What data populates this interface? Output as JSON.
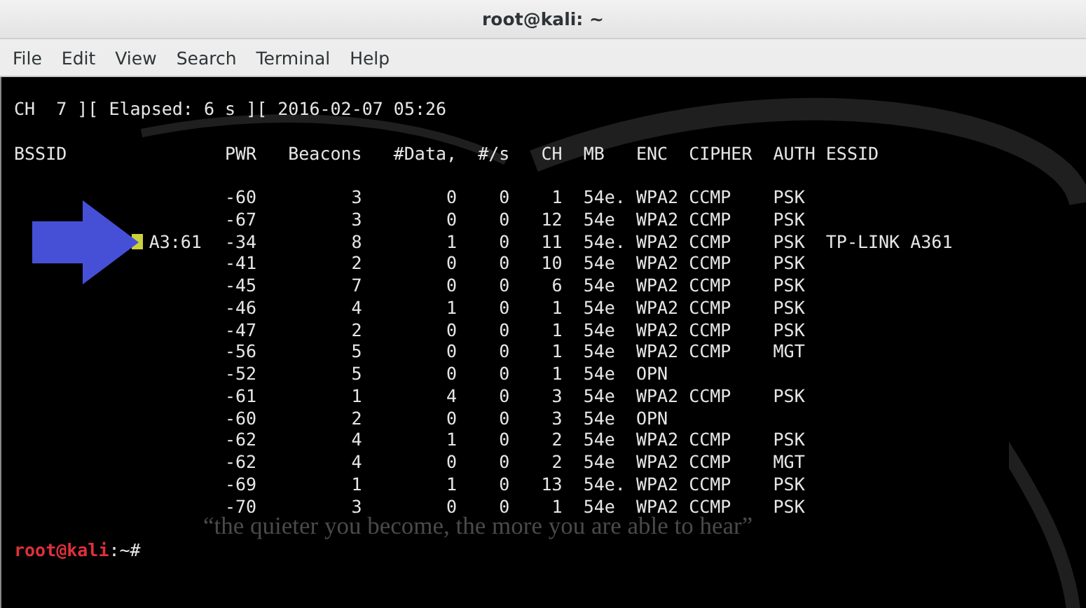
{
  "window": {
    "title": "root@kali: ~"
  },
  "menu": [
    "File",
    "Edit",
    "View",
    "Search",
    "Terminal",
    "Help"
  ],
  "status_line": "CH  7 ][ Elapsed: 6 s ][ 2016-02-07 05:26",
  "table": {
    "columns": [
      "BSSID",
      "PWR",
      "Beacons",
      "#Data,",
      "#/s",
      "CH",
      "MB",
      "ENC",
      "CIPHER",
      "AUTH",
      "ESSID"
    ],
    "rows": [
      {
        "pwr": "-60",
        "beacons": "3",
        "data_count": "0",
        "per_second": "0",
        "ch": "1",
        "mb": "54e.",
        "enc": "WPA2",
        "cipher": "CCMP",
        "auth": "PSK"
      },
      {
        "pwr": "-67",
        "beacons": "3",
        "data_count": "0",
        "per_second": "0",
        "ch": "12",
        "mb": "54e",
        "enc": "WPA2",
        "cipher": "CCMP",
        "auth": "PSK"
      },
      {
        "bssid": "A3:61",
        "pwr": "-34",
        "beacons": "8",
        "data_count": "1",
        "per_second": "0",
        "ch": "11",
        "mb": "54e.",
        "enc": "WPA2",
        "cipher": "CCMP",
        "auth": "PSK",
        "essid": "TP-LINK A361"
      },
      {
        "pwr": "-41",
        "beacons": "2",
        "data_count": "0",
        "per_second": "0",
        "ch": "10",
        "mb": "54e",
        "enc": "WPA2",
        "cipher": "CCMP",
        "auth": "PSK"
      },
      {
        "pwr": "-45",
        "beacons": "7",
        "data_count": "0",
        "per_second": "0",
        "ch": "6",
        "mb": "54e",
        "enc": "WPA2",
        "cipher": "CCMP",
        "auth": "PSK"
      },
      {
        "pwr": "-46",
        "beacons": "4",
        "data_count": "1",
        "per_second": "0",
        "ch": "1",
        "mb": "54e",
        "enc": "WPA2",
        "cipher": "CCMP",
        "auth": "PSK"
      },
      {
        "pwr": "-47",
        "beacons": "2",
        "data_count": "0",
        "per_second": "0",
        "ch": "1",
        "mb": "54e",
        "enc": "WPA2",
        "cipher": "CCMP",
        "auth": "PSK"
      },
      {
        "pwr": "-56",
        "beacons": "5",
        "data_count": "0",
        "per_second": "0",
        "ch": "1",
        "mb": "54e",
        "enc": "WPA2",
        "cipher": "CCMP",
        "auth": "MGT"
      },
      {
        "pwr": "-52",
        "beacons": "5",
        "data_count": "0",
        "per_second": "0",
        "ch": "1",
        "mb": "54e",
        "enc": "OPN"
      },
      {
        "pwr": "-61",
        "beacons": "1",
        "data_count": "4",
        "per_second": "0",
        "ch": "3",
        "mb": "54e",
        "enc": "WPA2",
        "cipher": "CCMP",
        "auth": "PSK"
      },
      {
        "pwr": "-60",
        "beacons": "2",
        "data_count": "0",
        "per_second": "0",
        "ch": "3",
        "mb": "54e",
        "enc": "OPN"
      },
      {
        "pwr": "-62",
        "beacons": "4",
        "data_count": "1",
        "per_second": "0",
        "ch": "2",
        "mb": "54e",
        "enc": "WPA2",
        "cipher": "CCMP",
        "auth": "PSK"
      },
      {
        "pwr": "-62",
        "beacons": "4",
        "data_count": "0",
        "per_second": "0",
        "ch": "2",
        "mb": "54e",
        "enc": "WPA2",
        "cipher": "CCMP",
        "auth": "MGT"
      },
      {
        "pwr": "-69",
        "beacons": "1",
        "data_count": "1",
        "per_second": "0",
        "ch": "13",
        "mb": "54e.",
        "enc": "WPA2",
        "cipher": "CCMP",
        "auth": "PSK"
      },
      {
        "pwr": "-70",
        "beacons": "3",
        "data_count": "0",
        "per_second": "0",
        "ch": "1",
        "mb": "54e",
        "enc": "WPA2",
        "cipher": "CCMP",
        "auth": "PSK"
      }
    ]
  },
  "background_tagline": "“the quieter you become, the more you are able to hear”",
  "prompt": {
    "user_host": "root@kali",
    "path": ":~#"
  }
}
